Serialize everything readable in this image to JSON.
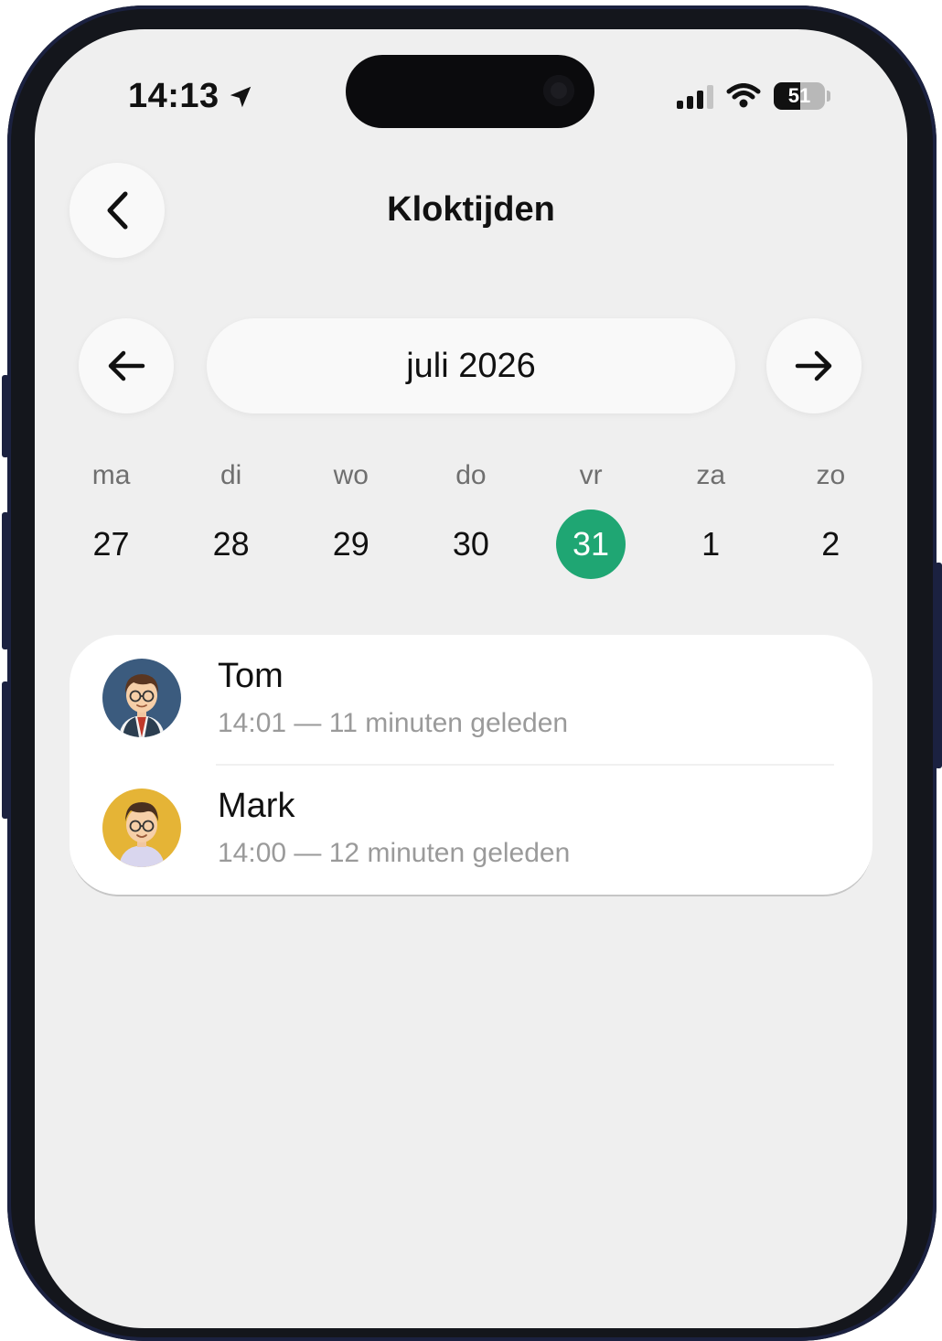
{
  "status_bar": {
    "time": "14:13",
    "battery": "51",
    "battery_level": 0.51
  },
  "header": {
    "title": "Kloktijden",
    "back_icon": "chevron-left-icon"
  },
  "month_nav": {
    "prev_icon": "arrow-left-icon",
    "label": "juli 2026",
    "next_icon": "arrow-right-icon"
  },
  "week": {
    "days": [
      {
        "name": "ma",
        "num": "27",
        "selected": false
      },
      {
        "name": "di",
        "num": "28",
        "selected": false
      },
      {
        "name": "wo",
        "num": "29",
        "selected": false
      },
      {
        "name": "do",
        "num": "30",
        "selected": false
      },
      {
        "name": "vr",
        "num": "31",
        "selected": true
      },
      {
        "name": "za",
        "num": "1",
        "selected": false
      },
      {
        "name": "zo",
        "num": "2",
        "selected": false
      }
    ],
    "accent_color": "#1fa673"
  },
  "entries": [
    {
      "name": "Tom",
      "detail": "14:01 — 11 minuten geleden",
      "avatar_icon": "man-with-glasses-avatar",
      "avatar_bg": "#3b5b7e"
    },
    {
      "name": "Mark",
      "detail": "14:00 — 12 minuten geleden",
      "avatar_icon": "man-with-glasses-avatar",
      "avatar_bg": "#e5b436"
    }
  ]
}
